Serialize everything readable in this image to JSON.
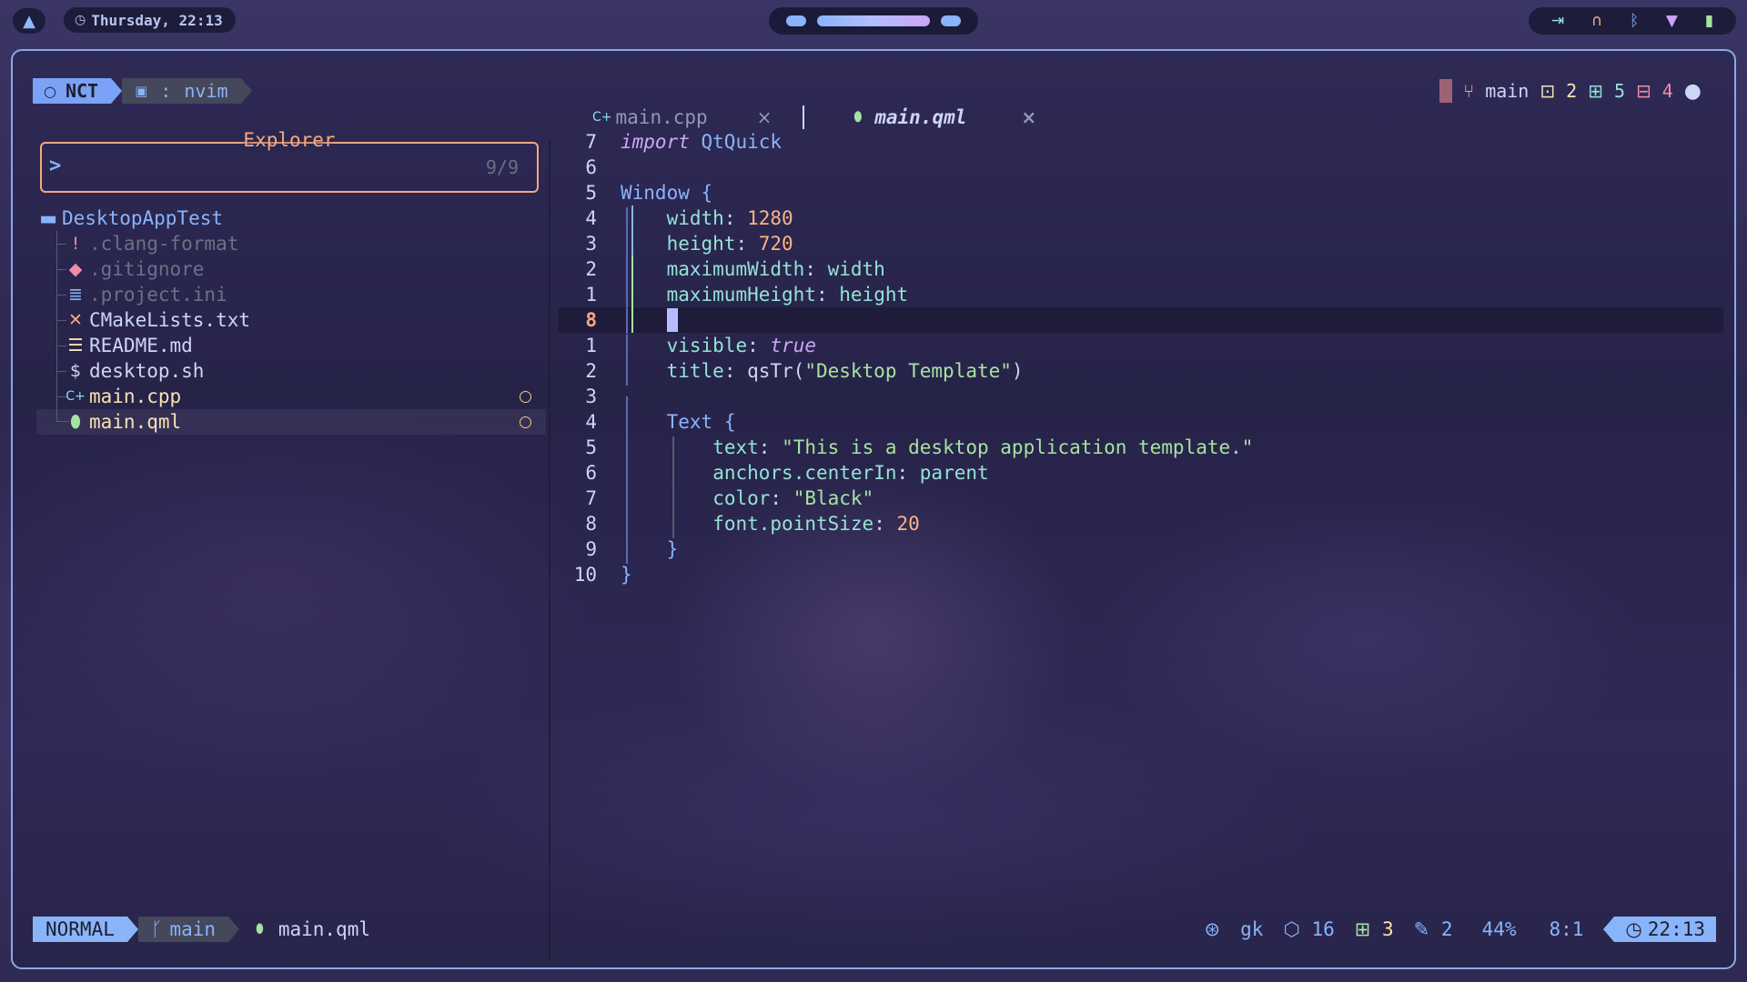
{
  "colors": {
    "accent": "#89b4fa",
    "explorer_border": "#f5a97f",
    "cursor_line_number": "#f5a97f",
    "git_added": "#a6e3a1",
    "git_changed": "#f9e2af",
    "git_removed": "#f38ba8"
  },
  "topbar": {
    "launcher_icon": "arch-logo-icon",
    "clock": "Thursday, 22:13",
    "tray_icons": [
      "logout-icon",
      "headphones-icon",
      "bluetooth-icon",
      "wifi-icon",
      "battery-icon"
    ]
  },
  "prompt": {
    "host": "NCT",
    "terminal_icon": "terminal-icon",
    "separator": ":",
    "process": "nvim"
  },
  "git": {
    "branch": "main",
    "changed": "2",
    "added": "5",
    "removed": "4",
    "github_icon": "github-icon"
  },
  "explorer": {
    "title": "Explorer",
    "prompt": ">",
    "count": "9/9",
    "root": "DesktopAppTest",
    "files": [
      {
        "name": ".clang-format",
        "icon": "!",
        "icon_color": "#f38ba8",
        "dim": true
      },
      {
        "name": ".gitignore",
        "icon": "◆",
        "icon_color": "#f38ba8",
        "dim": true
      },
      {
        "name": ".project.ini",
        "icon": "≣",
        "icon_color": "#89b4fa",
        "dim": true
      },
      {
        "name": "CMakeLists.txt",
        "icon": "✕",
        "icon_color": "#f5a97f",
        "dim": false
      },
      {
        "name": "README.md",
        "icon": "☰",
        "icon_color": "#f9e2af",
        "dim": false
      },
      {
        "name": "desktop.sh",
        "icon": "$",
        "icon_color": "#cdd6f4",
        "dim": false
      },
      {
        "name": "main.cpp",
        "icon": "C+",
        "icon_color": "#89dceb",
        "dim": false,
        "modified": true
      },
      {
        "name": "main.qml",
        "icon": "⬮",
        "icon_color": "#a6e3a1",
        "dim": false,
        "modified": true,
        "selected": true
      }
    ]
  },
  "tabs": [
    {
      "label": "main.cpp",
      "icon": "C+",
      "active": false,
      "close": "×"
    },
    {
      "label": "main.qml",
      "icon": "⬮",
      "active": true,
      "close": "×"
    }
  ],
  "editor": {
    "lines": [
      {
        "num": "7",
        "text": "import QtQuick"
      },
      {
        "num": "6",
        "text": ""
      },
      {
        "num": "5",
        "text": "Window {"
      },
      {
        "num": "4",
        "text": "width: 1280"
      },
      {
        "num": "3",
        "text": "height: 720"
      },
      {
        "num": "2",
        "text": "maximumWidth: width"
      },
      {
        "num": "1",
        "text": "maximumHeight: height"
      },
      {
        "num": "8",
        "text": "",
        "current": true
      },
      {
        "num": "1",
        "text": "visible: true"
      },
      {
        "num": "2",
        "text": "title: qsTr(\"Desktop Template\")"
      },
      {
        "num": "3",
        "text": ""
      },
      {
        "num": "4",
        "text": "Text {"
      },
      {
        "num": "5",
        "text": "text: \"This is a desktop application template.\""
      },
      {
        "num": "6",
        "text": "anchors.centerIn: parent"
      },
      {
        "num": "7",
        "text": "color: \"Black\""
      },
      {
        "num": "8",
        "text": "font.pointSize: 20"
      },
      {
        "num": "9",
        "text": "}"
      },
      {
        "num": "10",
        "text": "}"
      }
    ]
  },
  "status": {
    "mode": "NORMAL",
    "branch": "main",
    "file": "main.qml",
    "copilot_icon": "copilot-icon",
    "keys": "gk",
    "packages": "16",
    "added": "3",
    "modified": "2",
    "progress": "44%",
    "position": "8:1",
    "time": "22:13"
  }
}
